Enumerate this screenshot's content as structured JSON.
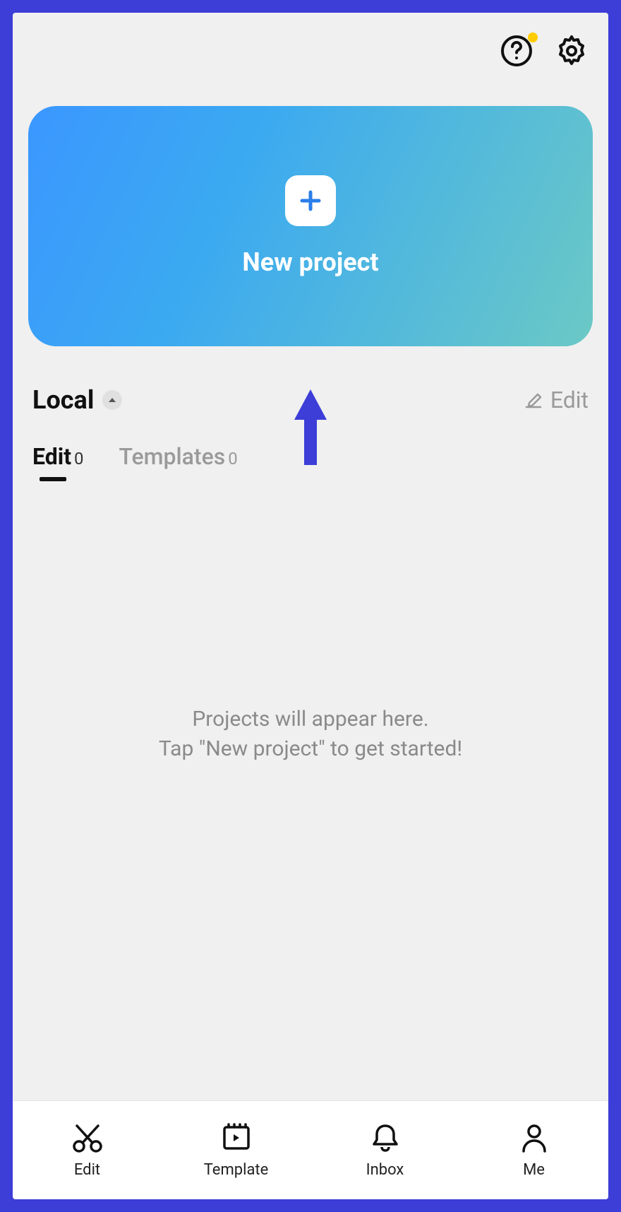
{
  "header": {
    "help_has_notification": true
  },
  "new_project": {
    "label": "New project"
  },
  "local": {
    "label": "Local",
    "edit_action_label": "Edit"
  },
  "tabs": [
    {
      "label": "Edit",
      "count": "0",
      "active": true
    },
    {
      "label": "Templates",
      "count": "0",
      "active": false
    }
  ],
  "empty_state": {
    "line1": "Projects will appear here.",
    "line2": "Tap \"New project\" to get started!"
  },
  "bottom_nav": [
    {
      "label": "Edit"
    },
    {
      "label": "Template"
    },
    {
      "label": "Inbox"
    },
    {
      "label": "Me"
    }
  ]
}
